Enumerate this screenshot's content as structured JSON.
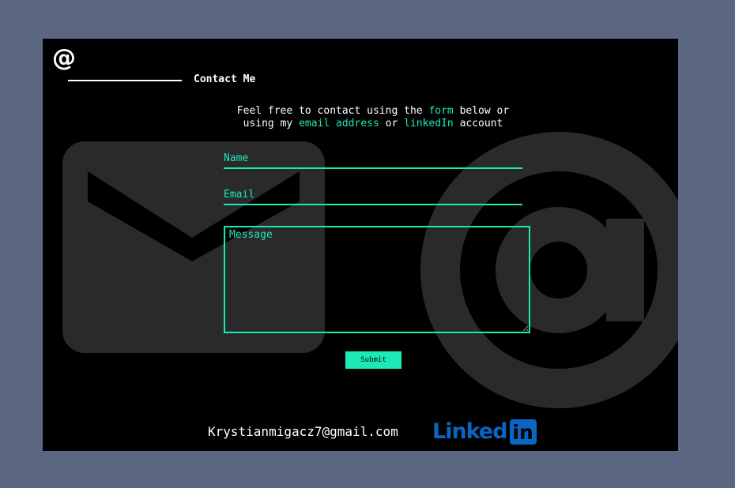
{
  "colors": {
    "page_background": "#5b6680",
    "panel_background": "#000000",
    "accent": "#1de9b6",
    "linkedin_blue": "#0a66c2"
  },
  "logo": {
    "icon": "at-sign-icon",
    "glyph": "@"
  },
  "heading": "Contact Me",
  "intro": {
    "part1": "Feel free to contact using the ",
    "form_link": "form",
    "part2": " below or",
    "part3": "using my ",
    "email_link": "email address",
    "part4": " or ",
    "linkedin_link": "linkedIn",
    "part5": " account"
  },
  "form": {
    "name_placeholder": "Name",
    "email_placeholder": "Email",
    "message_placeholder": "Message",
    "submit_label": "Submit"
  },
  "footer": {
    "email": "Krystianmigacz7@gmail.com",
    "linkedin_text": "Linked",
    "linkedin_badge": "in"
  },
  "background_icons": [
    "envelope-icon",
    "at-sign-icon"
  ]
}
